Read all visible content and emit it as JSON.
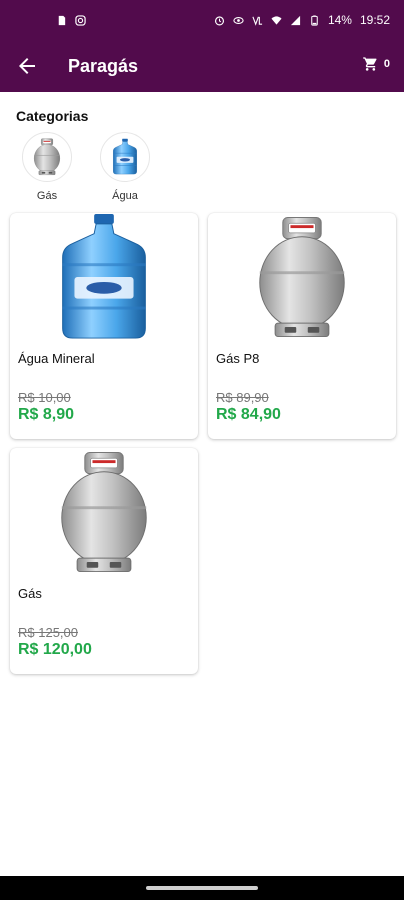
{
  "status_bar": {
    "battery": "14%",
    "time": "19:52",
    "icons": [
      "sim-icon",
      "instagram-icon",
      "alarm-icon",
      "eye-icon",
      "volte-icon",
      "wifi-icon",
      "signal-icon",
      "battery-icon"
    ]
  },
  "header": {
    "title": "Paragás",
    "cart_count": "0"
  },
  "categories": {
    "title": "Categorias",
    "items": [
      {
        "label": "Gás",
        "icon": "gas-cylinder-icon"
      },
      {
        "label": "Água",
        "icon": "water-jug-icon"
      }
    ]
  },
  "products": [
    {
      "name": "Água Mineral",
      "old_price": "R$ 10,00",
      "price": "R$ 8,90",
      "image": "water-jug-image"
    },
    {
      "name": "Gás P8",
      "old_price": "R$ 89,90",
      "price": "R$ 84,90",
      "image": "gas-cylinder-image"
    },
    {
      "name": "Gás",
      "old_price": "R$ 125,00",
      "price": "R$ 120,00",
      "image": "gas-cylinder-image"
    }
  ],
  "colors": {
    "brand": "#520b4c",
    "price": "#22a84a"
  }
}
